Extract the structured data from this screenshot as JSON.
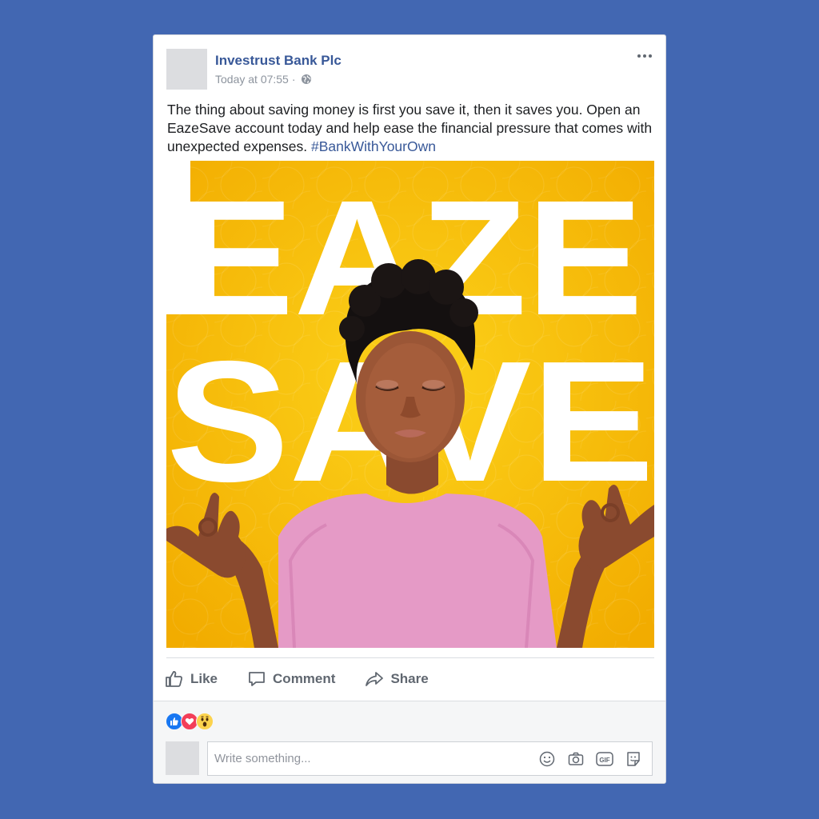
{
  "post": {
    "page_name": "Investrust Bank Plc",
    "timestamp": "Today at 07:55",
    "separator": "·",
    "privacy_icon": "globe-icon",
    "more_icon": "more-options-icon",
    "text": "The thing about saving money is first you save it, then it saves you. Open an EazeSave account today and help ease the financial pressure that comes with unexpected expenses.",
    "hashtag": "#BankWithYourOwn"
  },
  "image": {
    "headline_line1": "EAZE",
    "headline_line2": "SAVE",
    "background_color": "#f5b800"
  },
  "actions": [
    {
      "label": "Like",
      "icon": "thumbs-up-icon"
    },
    {
      "label": "Comment",
      "icon": "comment-bubble-icon"
    },
    {
      "label": "Share",
      "icon": "share-arrow-icon"
    }
  ],
  "reactions": [
    "like-reaction-icon",
    "love-reaction-icon",
    "wow-reaction-icon"
  ],
  "comment": {
    "placeholder": "Write something...",
    "tools": [
      "emoji-icon",
      "camera-icon",
      "gif-icon",
      "sticker-icon"
    ]
  },
  "colors": {
    "background": "#4267b2",
    "link": "#385898",
    "secondary_text": "#8d949e"
  }
}
